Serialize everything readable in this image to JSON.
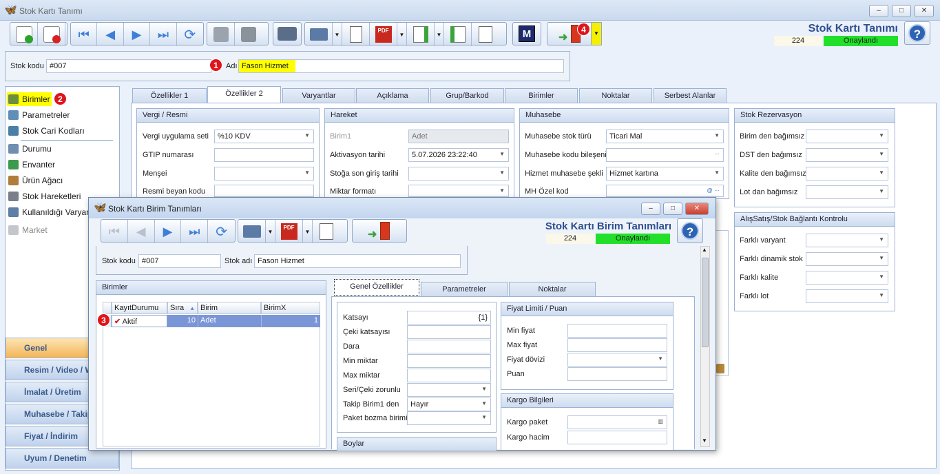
{
  "window": {
    "title": "Stok Kartı Tanımı",
    "min": "–",
    "max": "□",
    "close": "✕"
  },
  "header": {
    "title": "Stok Kartı Tanımı",
    "count": "224",
    "status": "Onaylandı",
    "help": "?",
    "m_label": "M"
  },
  "stock": {
    "code_label": "Stok kodu",
    "code_value": "#007",
    "name_label": "Adı",
    "name_value": "Fason Hizmet"
  },
  "badges": {
    "b1": "1",
    "b2": "2",
    "b3": "3",
    "b4": "4"
  },
  "nav": {
    "items": [
      "Birimler",
      "Parametreler",
      "Stok Cari Kodları",
      "Durumu",
      "Envanter",
      "Ürün Ağacı",
      "Stok Hareketleri",
      "Kullanıldığı Varyant",
      "Market"
    ]
  },
  "groups": [
    "Genel",
    "Resim / Video / W",
    "İmalat / Üretim",
    "Muhasebe / Takip",
    "Fiyat / İndirim",
    "Uyum / Denetim"
  ],
  "tabs": [
    "Özellikler 1",
    "Özellikler 2",
    "Varyantlar",
    "Açıklama",
    "Grup/Barkod",
    "Birimler",
    "Noktalar",
    "Serbest Alanlar"
  ],
  "vergi": {
    "title": "Vergi / Resmi",
    "rows": [
      {
        "label": "Vergi uygulama seti",
        "value": "%10 KDV"
      },
      {
        "label": "GTIP numarası",
        "value": ""
      },
      {
        "label": "Menşei",
        "value": ""
      },
      {
        "label": "Resmi beyan kodu",
        "value": ""
      }
    ]
  },
  "hareket": {
    "title": "Hareket",
    "rows": [
      {
        "label": "Birim1",
        "value": "Adet"
      },
      {
        "label": "Aktivasyon tarihi",
        "value": "5.07.2026 23:22:40"
      },
      {
        "label": "Stoğa son giriş tarihi",
        "value": ""
      },
      {
        "label": "Miktar formatı",
        "value": ""
      }
    ]
  },
  "muhasebe": {
    "title": "Muhasebe",
    "rows": [
      {
        "label": "Muhasebe stok türü",
        "value": "Ticari Mal"
      },
      {
        "label": "Muhasebe kodu bileşeni",
        "value": ""
      },
      {
        "label": "Hizmet muhasebe şekli",
        "value": "Hizmet kartına"
      },
      {
        "label": "MH Özel kod",
        "value": ""
      }
    ]
  },
  "rezervasyon": {
    "title": "Stok Rezervasyon",
    "rows": [
      {
        "label": "Birim den bağımsız"
      },
      {
        "label": "DST den bağımsız"
      },
      {
        "label": "Kalite den bağımsız"
      },
      {
        "label": "Lot dan bağımsız"
      }
    ]
  },
  "alissatis": {
    "title": "AlışSatış/Stok Bağlantı Kontrolu",
    "rows": [
      {
        "label": "Farklı varyant"
      },
      {
        "label": "Farklı dinamik stok"
      },
      {
        "label": "Farklı kalite"
      },
      {
        "label": "Farklı lot"
      }
    ]
  },
  "dialog": {
    "title": "Stok Kartı Birim Tanımları",
    "header_title": "Stok Kartı Birim Tanımları",
    "count": "224",
    "status": "Onaylandı",
    "code_label": "Stok kodu",
    "code_value": "#007",
    "name_label": "Stok adı",
    "name_value": "Fason Hizmet",
    "birimler_title": "Birimler",
    "columns": [
      "KayıtDurumu",
      "Sıra",
      "Birim",
      "BirimX"
    ],
    "row": {
      "durum": "Aktif",
      "sira": "10",
      "birim": "Adet",
      "birimx": "1"
    },
    "tabs": [
      "Genel Özellikler",
      "Parametreler",
      "Noktalar"
    ],
    "fields": [
      {
        "label": "Katsayı",
        "value": "{1}"
      },
      {
        "label": "Çeki katsayısı",
        "value": ""
      },
      {
        "label": "Dara",
        "value": ""
      },
      {
        "label": "Min miktar",
        "value": ""
      },
      {
        "label": "Max miktar",
        "value": ""
      },
      {
        "label": "Seri/Çeki zorunlu",
        "value": ""
      },
      {
        "label": "Takip Birim1 den",
        "value": "Hayır"
      },
      {
        "label": "Paket bozma birimi",
        "value": ""
      }
    ],
    "boylar_title": "Boylar",
    "fiyat": {
      "title": "Fiyat Limiti / Puan",
      "rows": [
        "Min fiyat",
        "Max fiyat",
        "Fiyat dövizi",
        "Puan"
      ]
    },
    "kargo": {
      "title": "Kargo Bilgileri",
      "rows": [
        "Kargo paket",
        "Kargo hacim"
      ]
    }
  },
  "colors": {
    "accent": "#2f4f8f",
    "status_green": "#22e02a",
    "highlight": "#ffff00",
    "badge_red": "#e0141b"
  }
}
